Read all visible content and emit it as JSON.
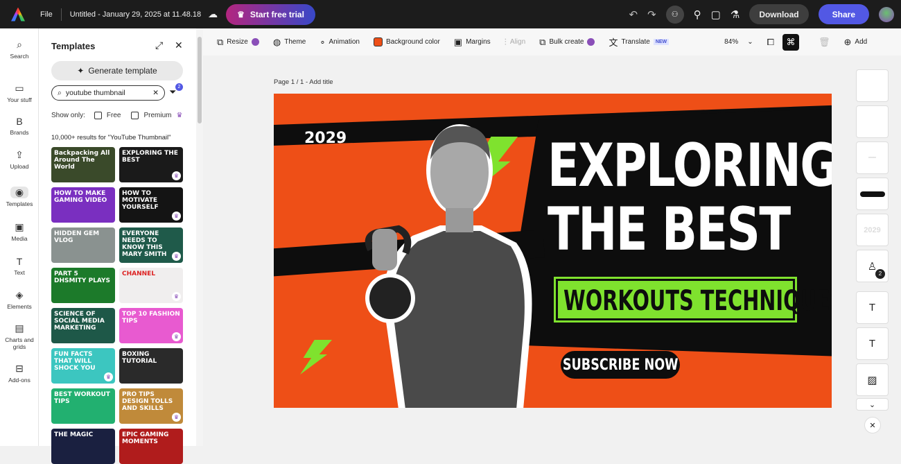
{
  "topbar": {
    "file": "File",
    "doc_title": "Untitled - January 29, 2025 at 11.48.18",
    "trial": "Start free trial",
    "download": "Download",
    "share": "Share"
  },
  "rail": [
    {
      "label": "Search",
      "icon": "search-icon",
      "glyph": "⌕"
    },
    {
      "label": "Your stuff",
      "icon": "folder-icon",
      "glyph": "▭"
    },
    {
      "label": "Brands",
      "icon": "brand-icon",
      "glyph": "B"
    },
    {
      "label": "Upload",
      "icon": "upload-icon",
      "glyph": "⇪"
    },
    {
      "label": "Templates",
      "icon": "templates-icon",
      "glyph": "◉"
    },
    {
      "label": "Media",
      "icon": "media-icon",
      "glyph": "▣"
    },
    {
      "label": "Text",
      "icon": "text-icon",
      "glyph": "T"
    },
    {
      "label": "Elements",
      "icon": "elements-icon",
      "glyph": "◈"
    },
    {
      "label": "Charts and grids",
      "icon": "chart-icon",
      "glyph": "▤"
    },
    {
      "label": "Add-ons",
      "icon": "addons-icon",
      "glyph": "⊟"
    }
  ],
  "panel": {
    "title": "Templates",
    "generate": "Generate template",
    "search_value": "youtube thumbnail",
    "filter_count": "2",
    "show_only": "Show only:",
    "free": "Free",
    "premium": "Premium",
    "results": "10,000+ results for \"YouTube Thumbnail\""
  },
  "templates": [
    {
      "text": "Backpacking All Around The World",
      "bg": "#3a4a2a",
      "premium": false
    },
    {
      "text": "EXPLORING THE BEST",
      "bg": "#1a1a1a",
      "premium": true
    },
    {
      "text": "HOW TO MAKE GAMING VIDEO",
      "bg": "#7a2fc0",
      "premium": false
    },
    {
      "text": "HOW TO MOTIVATE YOURSELF",
      "bg": "#141414",
      "premium": true
    },
    {
      "text": "HIDDEN GEM VLOG",
      "bg": "#8a9290",
      "premium": false
    },
    {
      "text": "EVERYONE NEEDS TO KNOW THIS MARY SMITH",
      "bg": "#1f5a4a",
      "premium": true
    },
    {
      "text": "PART 5 DHSMITY PLAYS",
      "bg": "#1c7a2a",
      "premium": false
    },
    {
      "text": "CHANNEL",
      "bg": "#f0eeee",
      "premium": true
    },
    {
      "text": "SCIENCE OF SOCIAL MEDIA MARKETING",
      "bg": "#1e5848",
      "premium": false
    },
    {
      "text": "TOP 10 FASHION TIPS",
      "bg": "#e85ad0",
      "premium": true
    },
    {
      "text": "FUN FACTS THAT WILL SHOCK YOU",
      "bg": "#3cc6c0",
      "premium": true
    },
    {
      "text": "BOXING TUTORIAL",
      "bg": "#2a2a2a",
      "premium": false
    },
    {
      "text": "BEST WORKOUT TIPS",
      "bg": "#22b070",
      "premium": false
    },
    {
      "text": "PRO TIPS DESIGN TOLLS AND SKILLS",
      "bg": "#c08a3a",
      "premium": true
    },
    {
      "text": "THE MAGIC",
      "bg": "#1a2040",
      "premium": false
    },
    {
      "text": "EPIC GAMING MOMENTS",
      "bg": "#b01c1c",
      "premium": false
    }
  ],
  "toolbar": {
    "resize": "Resize",
    "theme": "Theme",
    "animation": "Animation",
    "background": "Background color",
    "background_color": "#ee4f17",
    "margins": "Margins",
    "align": "Align",
    "bulk": "Bulk create",
    "translate": "Translate",
    "new": "NEW",
    "zoom": "84%",
    "add": "Add"
  },
  "canvas": {
    "page_label": "Page 1 / 1 - Add title",
    "year": "2029",
    "headline1": "EXPLORING",
    "headline2": "THE BEST",
    "subtitle": "WORKOUTS TECHNIQUES",
    "button": "SUBSCRIBE NOW"
  },
  "layers": {
    "text_icon": "T",
    "badge": "2",
    "small_text": "2029"
  },
  "colors": {
    "accent": "#5258e4",
    "orange": "#ee4f17",
    "green": "#7fe22e"
  }
}
